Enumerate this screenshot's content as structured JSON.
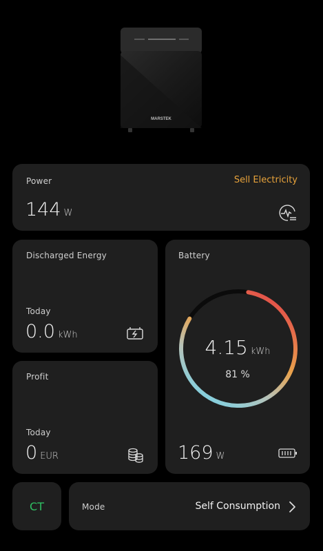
{
  "device": {
    "brand": "MARSTEK"
  },
  "power": {
    "label": "Power",
    "status": "Sell Electricity",
    "value": "144",
    "unit": "W",
    "icon": "power-curve-icon"
  },
  "discharged": {
    "label": "Discharged Energy",
    "period": "Today",
    "value": "0.0",
    "unit": "kWh",
    "icon": "battery-charge-icon"
  },
  "profit": {
    "label": "Profit",
    "period": "Today",
    "value": "0",
    "unit": "EUR",
    "icon": "coins-icon"
  },
  "battery": {
    "label": "Battery",
    "energy": "4.15",
    "energy_unit": "kWh",
    "percent_text": "81 %",
    "level_fraction": 0.81,
    "power": "169",
    "power_unit": "W",
    "icon": "battery-full-icon"
  },
  "ct": {
    "label": "CT"
  },
  "mode": {
    "label": "Mode",
    "value": "Self Consumption",
    "icon": "chevron-right-icon"
  },
  "colors": {
    "accent": "#e8a33b",
    "ct_green": "#2fbf62",
    "card": "#1f1f1f",
    "ring_start": "#e24a4a",
    "ring_end": "#7ad2e6"
  }
}
